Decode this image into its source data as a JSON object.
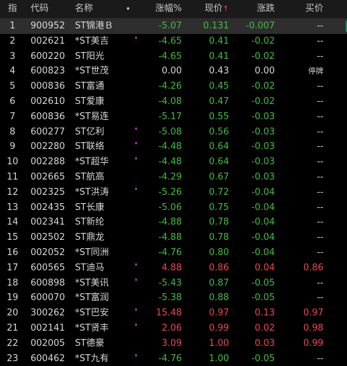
{
  "header": {
    "idx": "指",
    "code": "代码",
    "name": "名称",
    "menu": "•",
    "change_pct": "涨幅%",
    "price": "现价",
    "sort_arrow": "↑",
    "change": "涨跌",
    "bid": "买价"
  },
  "colors": {
    "up": "#f04848",
    "down": "#3fbf3f",
    "tag": "#e03ce0",
    "selected_row": "#2e2e2e"
  },
  "rows": [
    {
      "idx": "1",
      "code": "900952",
      "name": "ST锦港Ｂ",
      "tag": false,
      "chg": "-5.07",
      "price": "0.131",
      "diff": "-0.007",
      "bid": "--",
      "dir": "down",
      "selected": true
    },
    {
      "idx": "2",
      "code": "002621",
      "name": "*ST美吉",
      "tag": true,
      "chg": "-4.65",
      "price": "0.41",
      "diff": "-0.02",
      "bid": "--",
      "dir": "down"
    },
    {
      "idx": "3",
      "code": "600220",
      "name": "ST阳光",
      "tag": false,
      "chg": "-4.65",
      "price": "0.41",
      "diff": "-0.02",
      "bid": "--",
      "dir": "down"
    },
    {
      "idx": "4",
      "code": "600823",
      "name": "*ST世茂",
      "tag": false,
      "chg": "0.00",
      "price": "0.43",
      "diff": "0.00",
      "bid": "停牌",
      "dir": "flat"
    },
    {
      "idx": "5",
      "code": "000836",
      "name": "ST富通",
      "tag": false,
      "chg": "-4.26",
      "price": "0.45",
      "diff": "-0.02",
      "bid": "--",
      "dir": "down"
    },
    {
      "idx": "6",
      "code": "002610",
      "name": "ST爱康",
      "tag": false,
      "chg": "-4.08",
      "price": "0.47",
      "diff": "-0.02",
      "bid": "--",
      "dir": "down"
    },
    {
      "idx": "7",
      "code": "600836",
      "name": "*ST易连",
      "tag": false,
      "chg": "-5.17",
      "price": "0.55",
      "diff": "-0.03",
      "bid": "--",
      "dir": "down"
    },
    {
      "idx": "8",
      "code": "600277",
      "name": "ST亿利",
      "tag": true,
      "chg": "-5.08",
      "price": "0.56",
      "diff": "-0.03",
      "bid": "--",
      "dir": "down"
    },
    {
      "idx": "9",
      "code": "002280",
      "name": "ST联络",
      "tag": true,
      "chg": "-4.48",
      "price": "0.64",
      "diff": "-0.03",
      "bid": "--",
      "dir": "down"
    },
    {
      "idx": "10",
      "code": "002288",
      "name": "*ST超华",
      "tag": true,
      "chg": "-4.48",
      "price": "0.64",
      "diff": "-0.03",
      "bid": "--",
      "dir": "down"
    },
    {
      "idx": "11",
      "code": "002665",
      "name": "ST航高",
      "tag": false,
      "chg": "-4.29",
      "price": "0.67",
      "diff": "-0.03",
      "bid": "--",
      "dir": "down"
    },
    {
      "idx": "12",
      "code": "002325",
      "name": "*ST洪涛",
      "tag": true,
      "chg": "-5.26",
      "price": "0.72",
      "diff": "-0.04",
      "bid": "--",
      "dir": "down"
    },
    {
      "idx": "13",
      "code": "002435",
      "name": "ST长康",
      "tag": false,
      "chg": "-5.06",
      "price": "0.75",
      "diff": "-0.04",
      "bid": "--",
      "dir": "down"
    },
    {
      "idx": "14",
      "code": "002341",
      "name": "ST新纶",
      "tag": false,
      "chg": "-4.88",
      "price": "0.78",
      "diff": "-0.04",
      "bid": "--",
      "dir": "down"
    },
    {
      "idx": "15",
      "code": "002502",
      "name": "ST鼎龙",
      "tag": false,
      "chg": "-4.88",
      "price": "0.78",
      "diff": "-0.04",
      "bid": "--",
      "dir": "down"
    },
    {
      "idx": "16",
      "code": "002052",
      "name": "*ST同洲",
      "tag": false,
      "chg": "-4.76",
      "price": "0.80",
      "diff": "-0.04",
      "bid": "--",
      "dir": "down"
    },
    {
      "idx": "17",
      "code": "600565",
      "name": "ST迪马",
      "tag": true,
      "chg": "4.88",
      "price": "0.86",
      "diff": "0.04",
      "bid": "0.86",
      "dir": "up"
    },
    {
      "idx": "18",
      "code": "600898",
      "name": "*ST美讯",
      "tag": true,
      "chg": "-5.43",
      "price": "0.87",
      "diff": "-0.05",
      "bid": "--",
      "dir": "down"
    },
    {
      "idx": "19",
      "code": "600070",
      "name": "*ST富润",
      "tag": false,
      "chg": "-5.38",
      "price": "0.88",
      "diff": "-0.05",
      "bid": "--",
      "dir": "down"
    },
    {
      "idx": "20",
      "code": "300262",
      "name": "*ST巴安",
      "tag": true,
      "chg": "15.48",
      "price": "0.97",
      "diff": "0.13",
      "bid": "0.97",
      "dir": "up"
    },
    {
      "idx": "21",
      "code": "002141",
      "name": "*ST贤丰",
      "tag": true,
      "chg": "2.06",
      "price": "0.99",
      "diff": "0.02",
      "bid": "0.98",
      "dir": "up"
    },
    {
      "idx": "22",
      "code": "002005",
      "name": "ST德豪",
      "tag": false,
      "chg": "3.09",
      "price": "1.00",
      "diff": "0.03",
      "bid": "0.99",
      "dir": "up"
    },
    {
      "idx": "23",
      "code": "600462",
      "name": "*ST九有",
      "tag": true,
      "chg": "-4.76",
      "price": "1.00",
      "diff": "-0.05",
      "bid": "--",
      "dir": "down"
    }
  ]
}
